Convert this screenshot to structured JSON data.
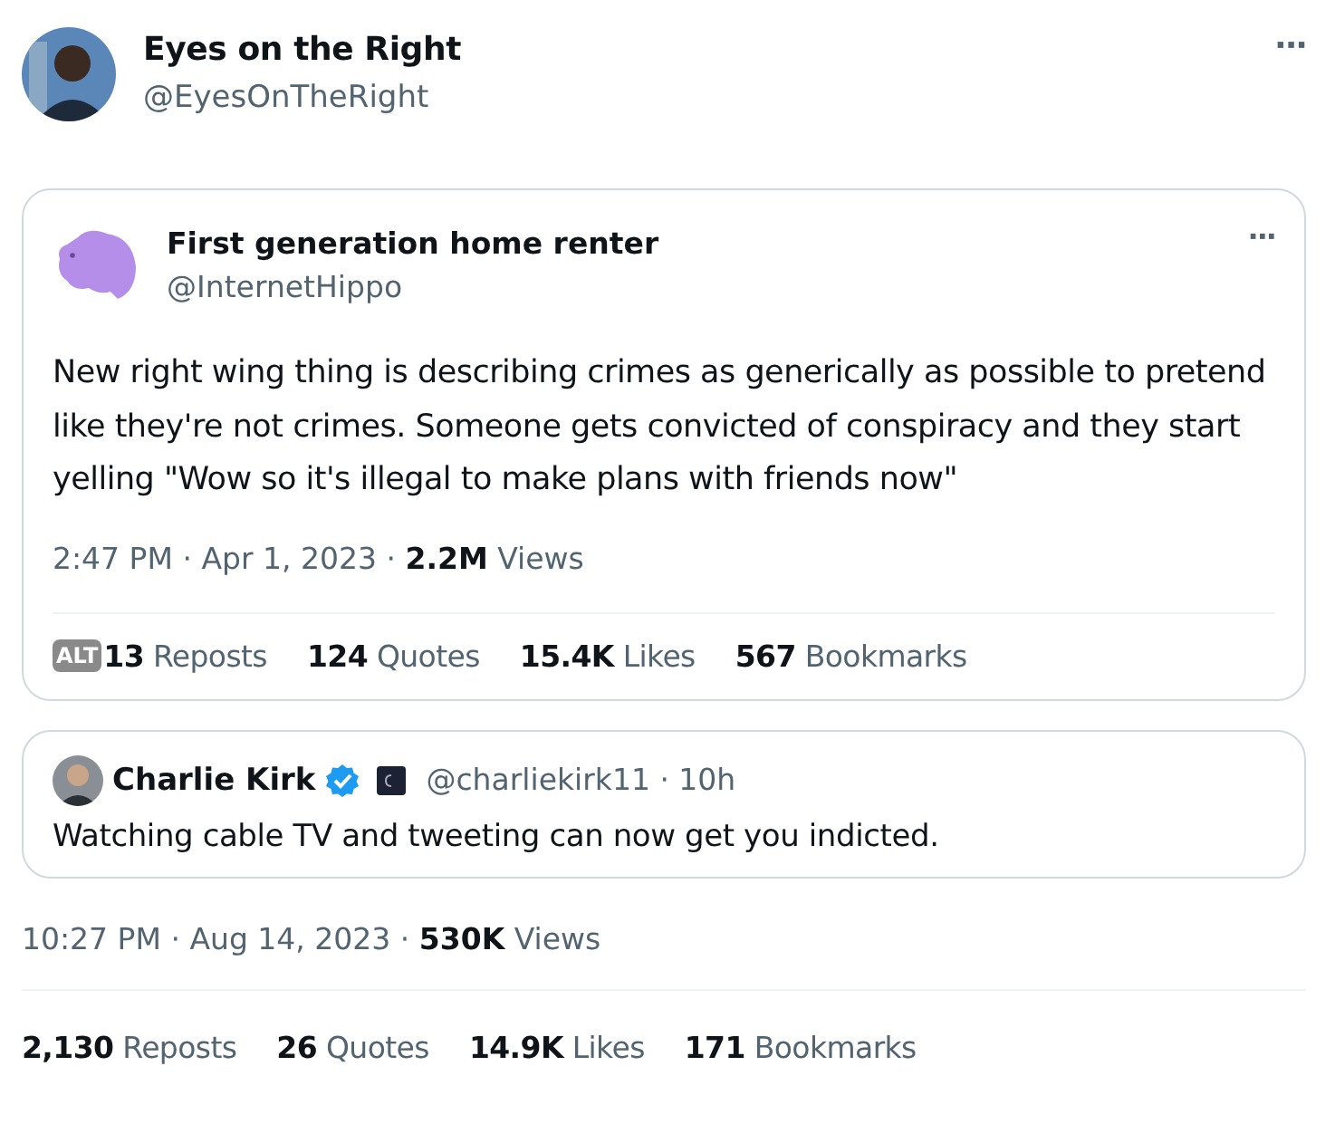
{
  "author": {
    "name": "Eyes on the Right",
    "handle": "@EyesOnTheRight",
    "more": "···"
  },
  "quoted_tweet": {
    "author": {
      "name": "First generation home renter",
      "handle": "@InternetHippo",
      "more": "···"
    },
    "text": "New right wing thing is describing crimes as generically as possible to pretend like they're not crimes. Someone gets convicted of conspiracy and they start yelling \"Wow so it's illegal to make plans with friends now\"",
    "time": "2:47 PM",
    "separator": "·",
    "date": "Apr 1, 2023",
    "views_count": "2.2M",
    "views_label": "Views",
    "alt_badge": "ALT",
    "stats": [
      {
        "count": "13",
        "label": "Reposts"
      },
      {
        "count": "124",
        "label": "Quotes"
      },
      {
        "count": "15.4K",
        "label": "Likes"
      },
      {
        "count": "567",
        "label": "Bookmarks"
      }
    ]
  },
  "embedded_tweet": {
    "author": {
      "name": "Charlie Kirk",
      "verified": true,
      "handle": "@charliekirk11",
      "separator": "·",
      "age": "10h"
    },
    "text": "Watching cable TV and tweeting can now get you indicted."
  },
  "time": "10:27 PM",
  "separator": "·",
  "date": "Aug 14, 2023",
  "views_count": "530K",
  "views_label": "Views",
  "stats": [
    {
      "count": "2,130",
      "label": "Reposts"
    },
    {
      "count": "26",
      "label": "Quotes"
    },
    {
      "count": "14.9K",
      "label": "Likes"
    },
    {
      "count": "171",
      "label": "Bookmarks"
    }
  ]
}
